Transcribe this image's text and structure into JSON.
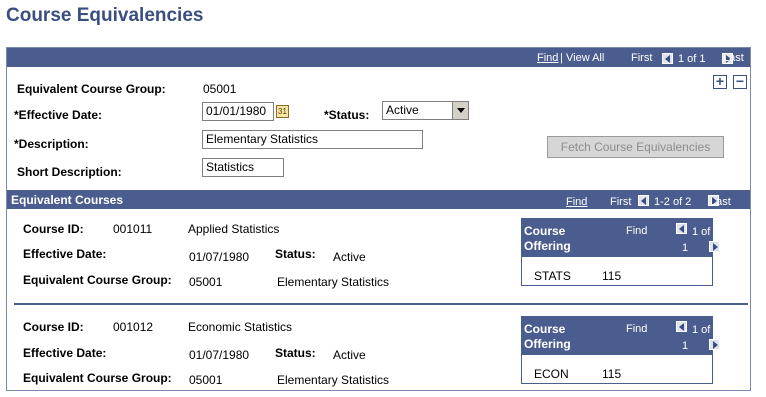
{
  "page_title": "Course Equivalencies",
  "main_nav": {
    "find": "Find",
    "view_all": "View All",
    "first": "First",
    "count": "1 of 1",
    "last": "Last"
  },
  "form": {
    "group_label": "Equivalent Course Group:",
    "group_value": "05001",
    "eff_date_label": "*Effective Date:",
    "eff_date_value": "01/01/1980",
    "status_label": "*Status:",
    "status_value": "Active",
    "desc_label": "*Description:",
    "desc_value": "Elementary Statistics",
    "short_desc_label": "Short Description:",
    "short_desc_value": "Statistics",
    "fetch_button": "Fetch Course Equivalencies",
    "add_button": "+",
    "remove_button": "−"
  },
  "equiv": {
    "title": "Equivalent Courses",
    "find": "Find",
    "first": "First",
    "count": "1-2 of 2",
    "last": "Last",
    "course_id_label": "Course ID:",
    "eff_date_label": "Effective Date:",
    "status_label": "Status:",
    "group_label": "Equivalent Course Group:",
    "rows": [
      {
        "course_id": "001011",
        "course_title": "Applied Statistics",
        "eff_date": "01/07/1980",
        "status": "Active",
        "group": "05001",
        "group_desc": "Elementary Statistics",
        "offering": {
          "title1": "Course",
          "title2": "Offering",
          "find": "Find",
          "count_a": "1 of",
          "count_b": "1",
          "subject": "STATS",
          "catalog": "115"
        }
      },
      {
        "course_id": "001012",
        "course_title": "Economic Statistics",
        "eff_date": "01/07/1980",
        "status": "Active",
        "group": "05001",
        "group_desc": "Elementary Statistics",
        "offering": {
          "title1": "Course",
          "title2": "Offering",
          "find": "Find",
          "count_a": "1 of",
          "count_b": "1",
          "subject": "ECON",
          "catalog": "115"
        }
      }
    ]
  },
  "icons": {
    "nav_prev": "left-arrow-icon",
    "nav_next": "right-arrow-icon",
    "calendar": "calendar-icon",
    "dropdown": "chevron-down-icon"
  },
  "colors": {
    "header_bar": "#4b5d8e",
    "title": "#3a4e82"
  }
}
